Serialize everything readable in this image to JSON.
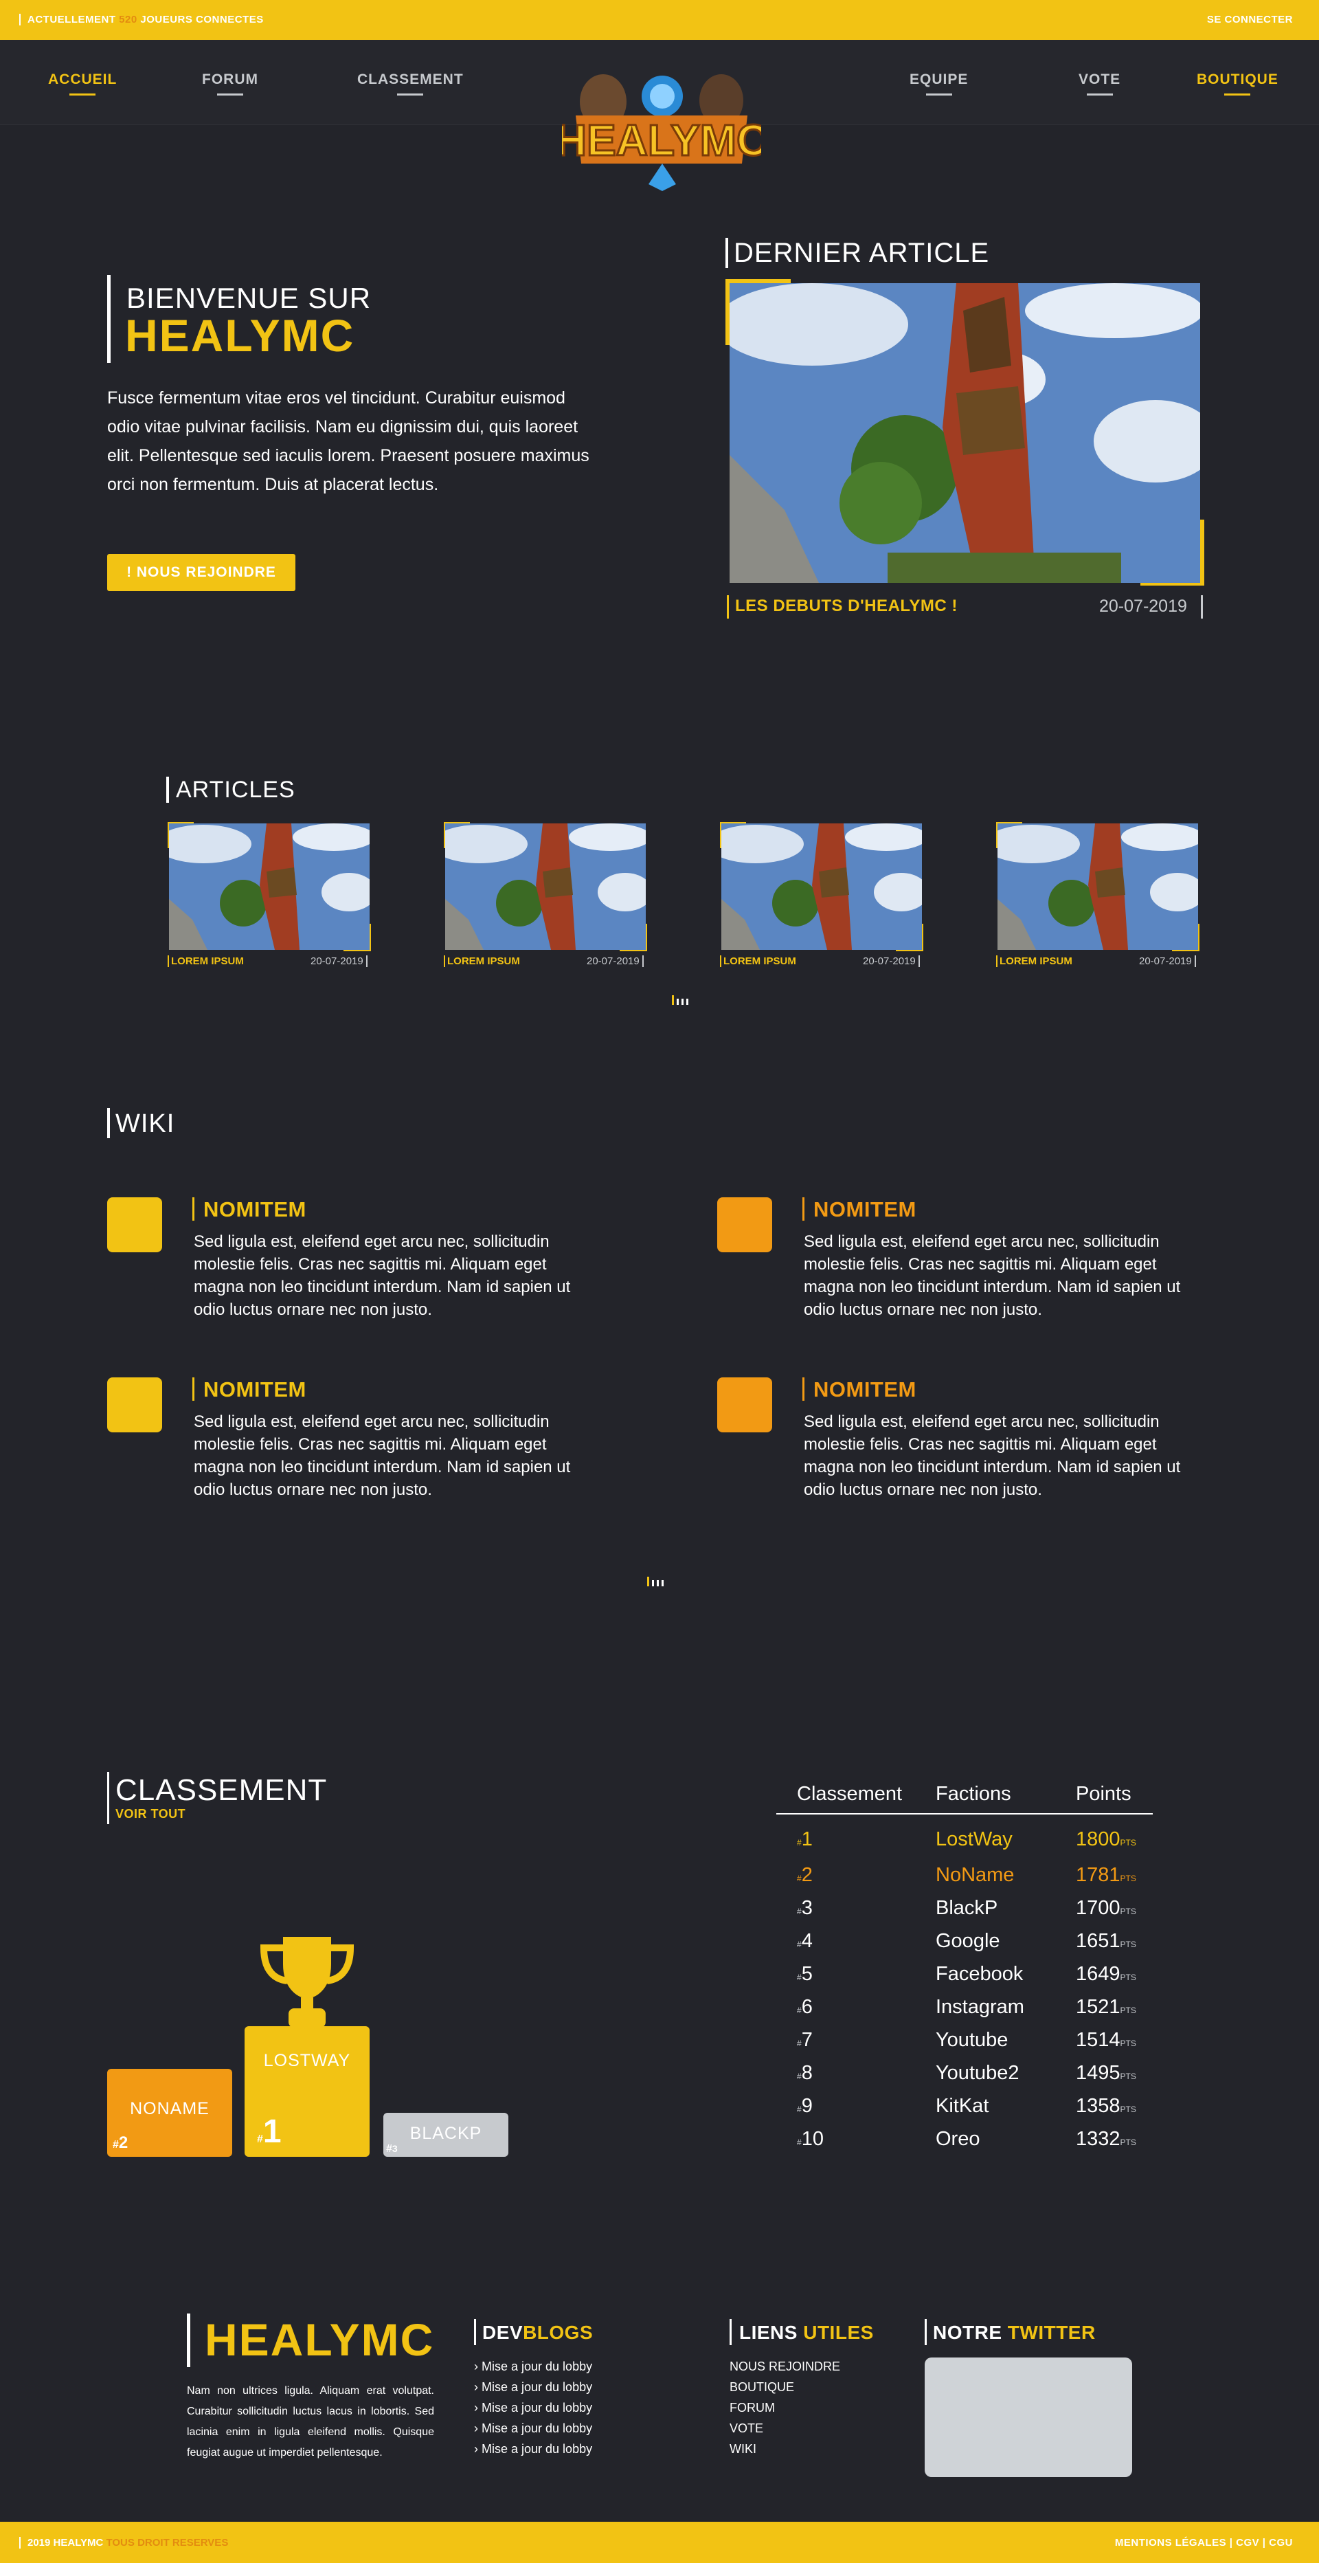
{
  "topbar": {
    "online_prefix": "ACTUELLEMENT",
    "online_count": "520",
    "online_suffix": "JOUEURS CONNECTES",
    "login": "SE CONNECTER"
  },
  "nav": {
    "items": [
      {
        "label": "ACCUEIL",
        "active": true
      },
      {
        "label": "FORUM"
      },
      {
        "label": "CLASSEMENT"
      },
      {
        "label": "EQUIPE"
      },
      {
        "label": "VOTE"
      },
      {
        "label": "BOUTIQUE",
        "active": true
      }
    ],
    "logo_text": "HEALYMC"
  },
  "hero": {
    "subtitle": "BIENVENUE SUR",
    "title": "HEALYMC",
    "text": "Fusce fermentum vitae eros vel tincidunt. Curabitur euismod odio vitae pulvinar facilisis. Nam eu dignissim dui, quis laoreet elit. Pellentesque sed iaculis lorem. Praesent posuere maximus orci non fermentum. Duis at placerat lectus.",
    "button": "! NOUS REJOINDRE"
  },
  "latest": {
    "heading": "DERNIER ARTICLE",
    "caption": "LES DEBUTS D'HEALYMC !",
    "date": "20-07-2019"
  },
  "articles": {
    "heading": "ARTICLES",
    "items": [
      {
        "label": "LOREM IPSUM",
        "date": "20-07-2019"
      },
      {
        "label": "LOREM IPSUM",
        "date": "20-07-2019"
      },
      {
        "label": "LOREM IPSUM",
        "date": "20-07-2019"
      },
      {
        "label": "LOREM IPSUM",
        "date": "20-07-2019"
      }
    ]
  },
  "wiki": {
    "heading": "WIKI",
    "items": [
      {
        "name": "NOMITEM",
        "text": "Sed ligula est, eleifend eget arcu nec, sollicitudin molestie felis. Cras nec sagittis mi. Aliquam eget magna non leo tincidunt interdum. Nam id sapien ut odio luctus ornare nec non justo.",
        "color": "#f2c314"
      },
      {
        "name": "NOMITEM",
        "text": "Sed ligula est, eleifend eget arcu nec, sollicitudin molestie felis. Cras nec sagittis mi. Aliquam eget magna non leo tincidunt interdum. Nam id sapien ut odio luctus ornare nec non justo.",
        "color": "#f29a14"
      },
      {
        "name": "NOMITEM",
        "text": "Sed ligula est, eleifend eget arcu nec, sollicitudin molestie felis. Cras nec sagittis mi. Aliquam eget magna non leo tincidunt interdum. Nam id sapien ut odio luctus ornare nec non justo.",
        "color": "#f2c314"
      },
      {
        "name": "NOMITEM",
        "text": "Sed ligula est, eleifend eget arcu nec, sollicitudin molestie felis. Cras nec sagittis mi. Aliquam eget magna non leo tincidunt interdum. Nam id sapien ut odio luctus ornare nec non justo.",
        "color": "#f29a14"
      }
    ]
  },
  "classement": {
    "heading": "CLASSEMENT",
    "sub": "VOIR TOUT",
    "podium": {
      "first": {
        "name": "LOSTWAY",
        "rank": "1"
      },
      "second": {
        "name": "NONAME",
        "rank": "2"
      },
      "third": {
        "name": "BLACKP",
        "rank": "3"
      }
    },
    "table": {
      "headers": [
        "Classement",
        "Factions",
        "Points"
      ],
      "rank_prefix": "#",
      "points_suffix": "PTS",
      "rows": [
        {
          "rank": "1",
          "faction": "LostWay",
          "points": "1800"
        },
        {
          "rank": "2",
          "faction": "NoName",
          "points": "1781"
        },
        {
          "rank": "3",
          "faction": "BlackP",
          "points": "1700"
        },
        {
          "rank": "4",
          "faction": "Google",
          "points": "1651"
        },
        {
          "rank": "5",
          "faction": "Facebook",
          "points": "1649"
        },
        {
          "rank": "6",
          "faction": "Instagram",
          "points": "1521"
        },
        {
          "rank": "7",
          "faction": "Youtube",
          "points": "1514"
        },
        {
          "rank": "8",
          "faction": "Youtube2",
          "points": "1495"
        },
        {
          "rank": "9",
          "faction": "KitKat",
          "points": "1358"
        },
        {
          "rank": "10",
          "faction": "Oreo",
          "points": "1332"
        }
      ]
    }
  },
  "footer": {
    "brand": "HEALYMC",
    "text": "Nam non ultrices ligula. Aliquam erat volutpat. Curabitur sollicitudin luctus lacus in lobortis. Sed lacinia enim in ligula eleifend mollis. Quisque feugiat augue ut imperdiet pellentesque.",
    "devblogs": {
      "title_a": "DEV",
      "title_b": "BLOGS",
      "items": [
        "Mise a jour du lobby",
        "Mise a jour du lobby",
        "Mise a jour du lobby",
        "Mise a jour du lobby",
        "Mise a jour du lobby"
      ]
    },
    "links": {
      "title_a": "LIENS ",
      "title_b": "UTILES",
      "items": [
        "NOUS REJOINDRE",
        "BOUTIQUE",
        "FORUM",
        "VOTE",
        "WIKI"
      ]
    },
    "twitter": {
      "title_a": "NOTRE ",
      "title_b": "TWITTER"
    },
    "copyright_a": "2019 HEALYMC",
    "copyright_b": "TOUS DROIT RESERVES",
    "legal": "MENTIONS LÉGALES | CGV | CGU"
  }
}
